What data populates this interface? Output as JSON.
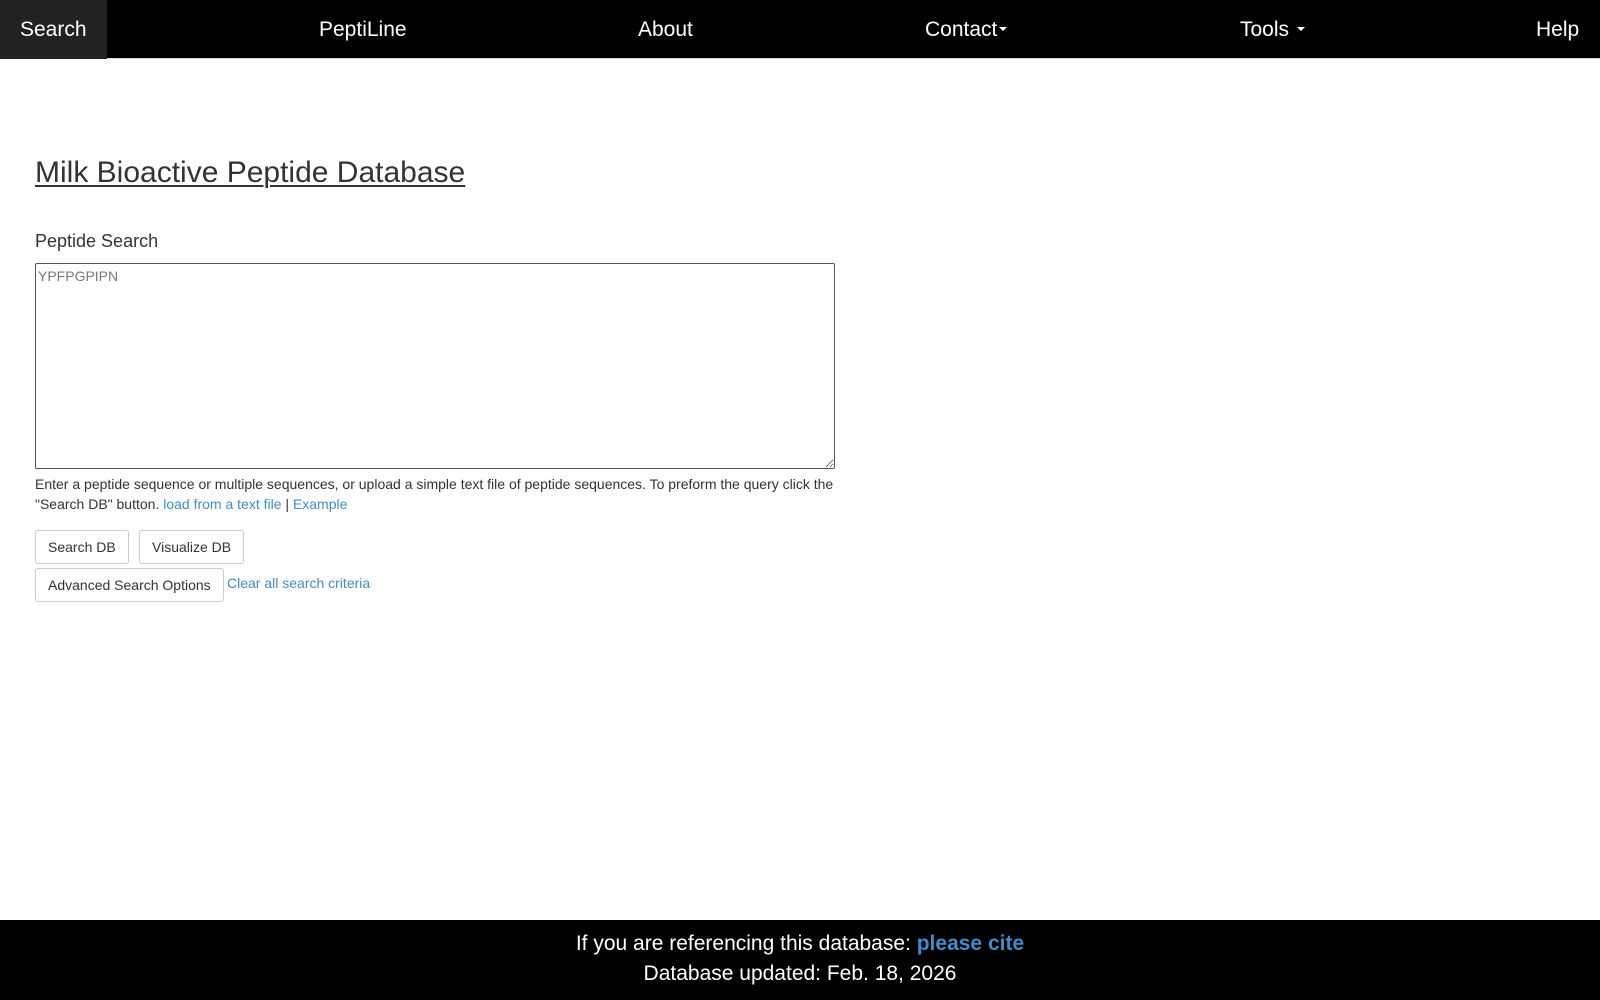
{
  "nav": {
    "search": "Search",
    "peptiline": "PeptiLine",
    "about": "About",
    "contact": "Contact",
    "tools": "Tools",
    "help": "Help"
  },
  "main": {
    "title": "Milk Bioactive Peptide Database",
    "search_label": "Peptide Search",
    "input_placeholder": "YPFPGPIPN",
    "input_value": "",
    "help_text": "Enter a peptide sequence or multiple sequences, or upload a simple text file of peptide sequences. To preform the query click the \"Search DB\" button.",
    "load_link": "load from a text file",
    "separator": "|",
    "example_link": "Example",
    "search_button": "Search DB",
    "visualize_button": "Visualize DB",
    "advanced_button": "Advanced Search Options",
    "clear_link": "Clear all search criteria"
  },
  "footer": {
    "reference_text": "If you are referencing this database:",
    "cite_link": "please cite",
    "updated_text": "Database updated: Feb. 18, 2026"
  },
  "colors": {
    "nav_background": "#000000",
    "link": "#428bca",
    "footer_background": "#000000"
  }
}
